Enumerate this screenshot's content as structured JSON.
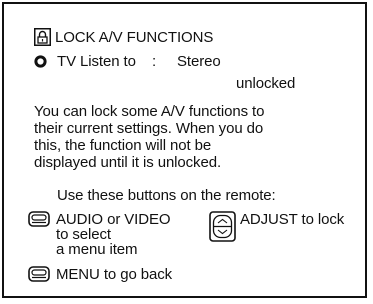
{
  "screen": {
    "title": "LOCK A/V FUNCTIONS",
    "menu_item": {
      "label": "TV Listen to",
      "separator": ":",
      "value": "Stereo",
      "status": "unlocked"
    },
    "description": [
      "You can lock some A/V functions to",
      "their current settings.  When you do",
      "this, the function will not be",
      "displayed until it is unlocked."
    ],
    "remote_heading": "Use these buttons on the remote:",
    "audio_video_hint": [
      "AUDIO or VIDEO",
      "to select",
      "a menu item"
    ],
    "adjust_hint": "ADJUST to lock",
    "menu_hint": "MENU to go back"
  },
  "icons": {
    "title": "lock-icon",
    "selected": "radio-selected-icon",
    "audio_video": "remote-button-icon",
    "adjust": "adjust-button-icon",
    "menu": "remote-button-icon"
  }
}
